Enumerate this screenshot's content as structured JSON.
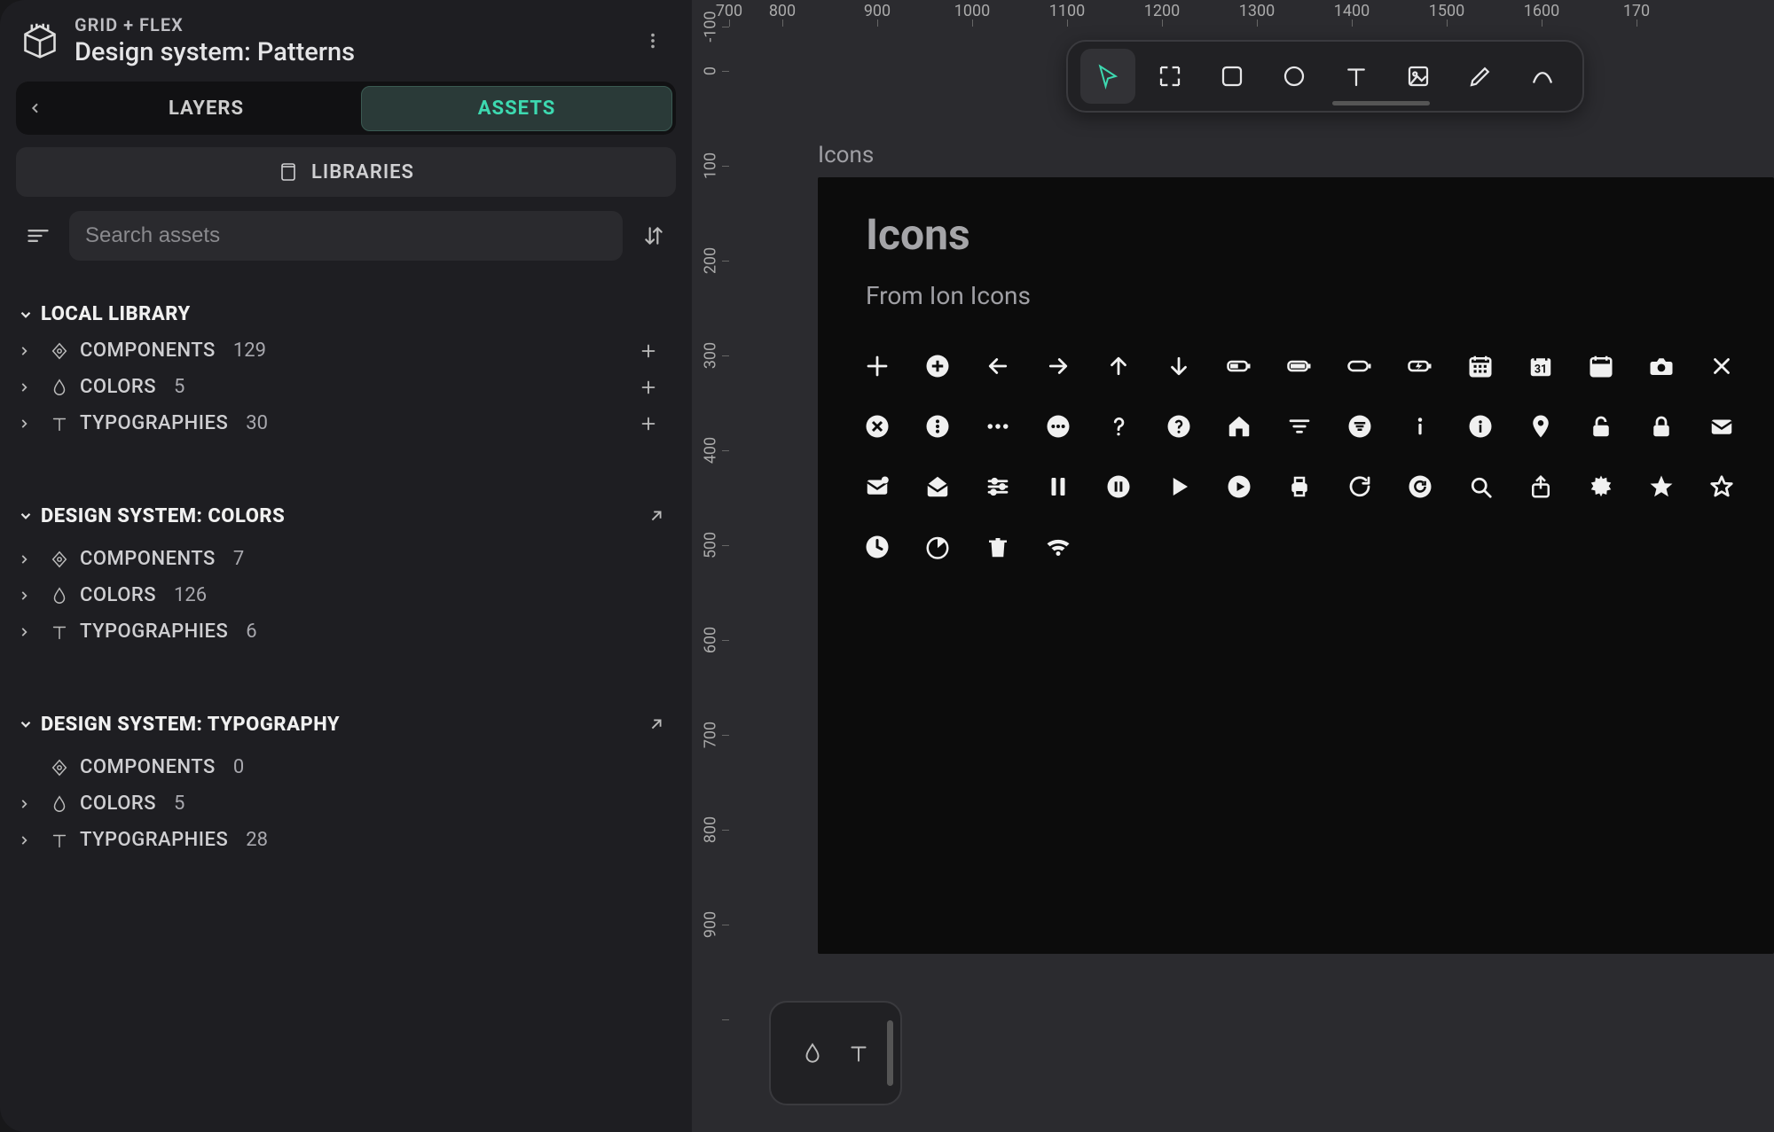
{
  "header": {
    "project": "GRID + FLEX",
    "file": "Design system: Patterns"
  },
  "tabs": {
    "layers": "LAYERS",
    "assets": "ASSETS",
    "active": "assets"
  },
  "libraries_button": "LIBRARIES",
  "search": {
    "placeholder": "Search assets"
  },
  "tree": {
    "groups": [
      {
        "id": "local",
        "title": "LOCAL LIBRARY",
        "external": false,
        "items": [
          {
            "kind": "components",
            "label": "COMPONENTS",
            "count": 129,
            "add": true,
            "expandable": true
          },
          {
            "kind": "colors",
            "label": "COLORS",
            "count": 5,
            "add": true,
            "expandable": true
          },
          {
            "kind": "typo",
            "label": "TYPOGRAPHIES",
            "count": 30,
            "add": true,
            "expandable": true
          }
        ]
      },
      {
        "id": "ds-colors",
        "title": "DESIGN SYSTEM: COLORS",
        "external": true,
        "items": [
          {
            "kind": "components",
            "label": "COMPONENTS",
            "count": 7,
            "add": false,
            "expandable": true
          },
          {
            "kind": "colors",
            "label": "COLORS",
            "count": 126,
            "add": false,
            "expandable": true
          },
          {
            "kind": "typo",
            "label": "TYPOGRAPHIES",
            "count": 6,
            "add": false,
            "expandable": true
          }
        ]
      },
      {
        "id": "ds-typo",
        "title": "DESIGN SYSTEM: TYPOGRAPHY",
        "external": true,
        "items": [
          {
            "kind": "components",
            "label": "COMPONENTS",
            "count": 0,
            "add": false,
            "expandable": false
          },
          {
            "kind": "colors",
            "label": "COLORS",
            "count": 5,
            "add": false,
            "expandable": true
          },
          {
            "kind": "typo",
            "label": "TYPOGRAPHIES",
            "count": 28,
            "add": false,
            "expandable": true
          }
        ]
      }
    ]
  },
  "canvas": {
    "ruler_h": [
      "700",
      "800",
      "900",
      "1000",
      "1100",
      "1200",
      "1300",
      "1400",
      "1500",
      "1600",
      "170"
    ],
    "ruler_v": [
      "-100",
      "0",
      "100",
      "200",
      "300",
      "400",
      "500",
      "600",
      "700",
      "800",
      "900",
      ""
    ],
    "frame_label": "Icons",
    "artboard": {
      "title": "Icons",
      "subtitle": "From Ion Icons",
      "icons": [
        "add",
        "add-circle",
        "arrow-left",
        "arrow-right",
        "arrow-up",
        "arrow-down",
        "battery-half",
        "battery-full",
        "battery-empty",
        "battery-charging",
        "calendar-grid",
        "calendar-date",
        "calendar-blank",
        "camera",
        "close",
        "close-circle",
        "ellipsis-vertical-circle",
        "ellipsis-horizontal",
        "ellipsis-horizontal-circle",
        "help",
        "help-circle",
        "home",
        "filter",
        "filter-circle",
        "information",
        "information-circle",
        "location",
        "lock-open",
        "lock-closed",
        "mail",
        "mail-unread",
        "mail-open",
        "options",
        "pause",
        "pause-circle",
        "play",
        "play-circle",
        "print",
        "reload",
        "reload-circle",
        "search",
        "share",
        "settings",
        "star",
        "star-outline",
        "time",
        "timer",
        "trash",
        "wifi"
      ]
    }
  },
  "toolbar": {
    "tools": [
      "pointer",
      "frame",
      "rect",
      "ellipse",
      "text",
      "image",
      "pencil",
      "curve"
    ],
    "active": "pointer"
  },
  "mini_toolbar": {
    "tools": [
      "drop",
      "text"
    ]
  }
}
